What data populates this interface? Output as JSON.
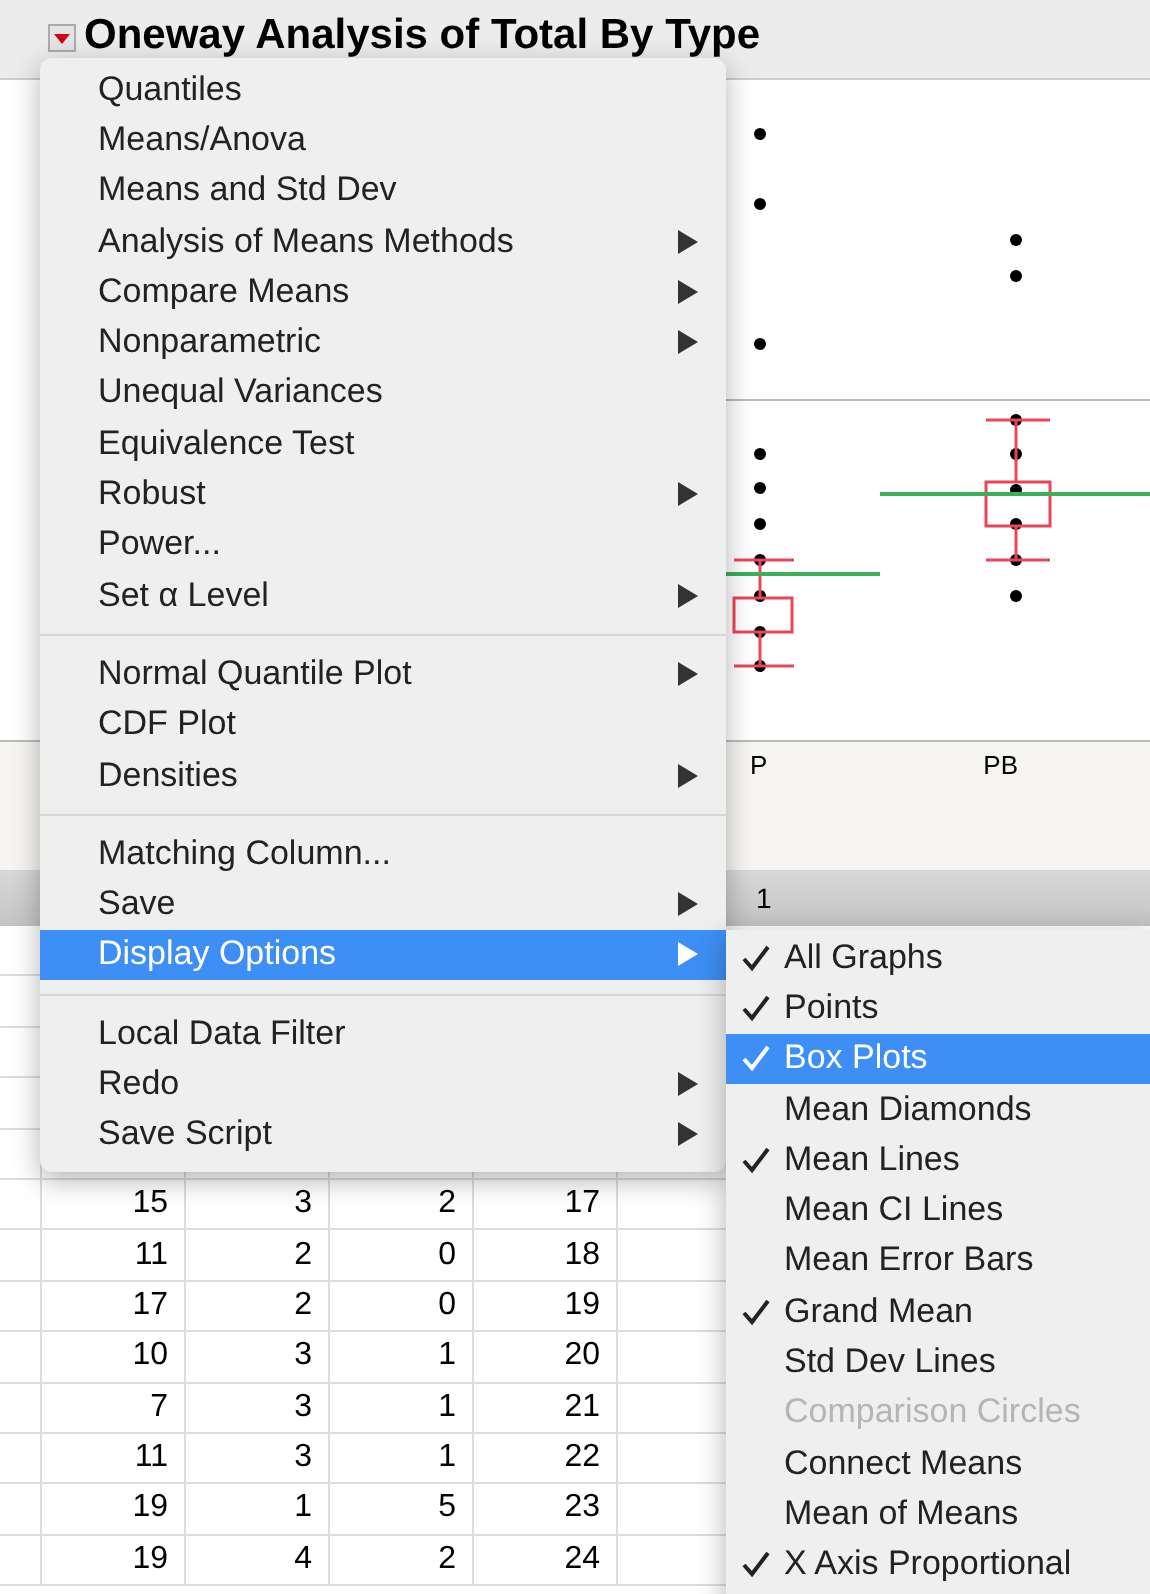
{
  "report": {
    "title": "Oneway Analysis of Total By Type",
    "axis_labels": [
      "P",
      "PB"
    ]
  },
  "table": {
    "header": "1",
    "rows": [
      [
        "15",
        "3",
        "2",
        "17"
      ],
      [
        "11",
        "2",
        "0",
        "18"
      ],
      [
        "17",
        "2",
        "0",
        "19"
      ],
      [
        "10",
        "3",
        "1",
        "20"
      ],
      [
        "7",
        "3",
        "1",
        "21"
      ],
      [
        "11",
        "3",
        "1",
        "22"
      ],
      [
        "19",
        "1",
        "5",
        "23"
      ],
      [
        "19",
        "4",
        "2",
        "24"
      ]
    ]
  },
  "menu": {
    "sections": [
      [
        {
          "label": "Quantiles",
          "submenu": false,
          "selected": false
        },
        {
          "label": "Means/Anova",
          "submenu": false,
          "selected": false
        },
        {
          "label": "Means and Std Dev",
          "submenu": false,
          "selected": false
        },
        {
          "label": "Analysis of Means Methods",
          "submenu": true,
          "selected": false
        },
        {
          "label": "Compare Means",
          "submenu": true,
          "selected": false
        },
        {
          "label": "Nonparametric",
          "submenu": true,
          "selected": false
        },
        {
          "label": "Unequal Variances",
          "submenu": false,
          "selected": false
        },
        {
          "label": "Equivalence Test",
          "submenu": false,
          "selected": false
        },
        {
          "label": "Robust",
          "submenu": true,
          "selected": false
        },
        {
          "label": "Power...",
          "submenu": false,
          "selected": false
        },
        {
          "label": "Set α Level",
          "submenu": true,
          "selected": false
        }
      ],
      [
        {
          "label": "Normal Quantile Plot",
          "submenu": true,
          "selected": false
        },
        {
          "label": "CDF Plot",
          "submenu": false,
          "selected": false
        },
        {
          "label": "Densities",
          "submenu": true,
          "selected": false
        }
      ],
      [
        {
          "label": "Matching Column...",
          "submenu": false,
          "selected": false
        },
        {
          "label": "Save",
          "submenu": true,
          "selected": false
        },
        {
          "label": "Display Options",
          "submenu": true,
          "selected": true
        }
      ],
      [
        {
          "label": "Local Data Filter",
          "submenu": false,
          "selected": false
        },
        {
          "label": "Redo",
          "submenu": true,
          "selected": false
        },
        {
          "label": "Save Script",
          "submenu": true,
          "selected": false
        }
      ]
    ]
  },
  "submenu": {
    "items": [
      {
        "label": "All Graphs",
        "checked": true,
        "selected": false,
        "disabled": false
      },
      {
        "label": "Points",
        "checked": true,
        "selected": false,
        "disabled": false
      },
      {
        "label": "Box Plots",
        "checked": true,
        "selected": true,
        "disabled": false
      },
      {
        "label": "Mean Diamonds",
        "checked": false,
        "selected": false,
        "disabled": false
      },
      {
        "label": "Mean Lines",
        "checked": true,
        "selected": false,
        "disabled": false
      },
      {
        "label": "Mean CI Lines",
        "checked": false,
        "selected": false,
        "disabled": false
      },
      {
        "label": "Mean Error Bars",
        "checked": false,
        "selected": false,
        "disabled": false
      },
      {
        "label": "Grand Mean",
        "checked": true,
        "selected": false,
        "disabled": false
      },
      {
        "label": "Std Dev Lines",
        "checked": false,
        "selected": false,
        "disabled": false
      },
      {
        "label": "Comparison Circles",
        "checked": false,
        "selected": false,
        "disabled": true
      },
      {
        "label": "Connect Means",
        "checked": false,
        "selected": false,
        "disabled": false
      },
      {
        "label": "Mean of Means",
        "checked": false,
        "selected": false,
        "disabled": false
      },
      {
        "label": "X Axis Proportional",
        "checked": true,
        "selected": false,
        "disabled": false
      }
    ]
  }
}
